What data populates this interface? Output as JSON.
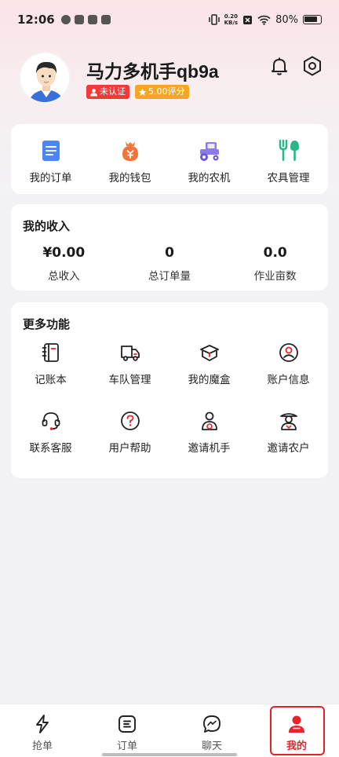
{
  "status_bar": {
    "time": "12:06",
    "speed_value": "0.20",
    "speed_unit": "KB/s",
    "battery": "80%"
  },
  "profile": {
    "name": "马力多机手qb9a",
    "verify_badge": "未认证",
    "rating_badge": "5.00评分"
  },
  "quick_actions": [
    {
      "label": "我的订单",
      "icon": "order-icon"
    },
    {
      "label": "我的钱包",
      "icon": "wallet-icon"
    },
    {
      "label": "我的农机",
      "icon": "tractor-icon"
    },
    {
      "label": "农具管理",
      "icon": "farm-tools-icon"
    }
  ],
  "income": {
    "title": "我的收入",
    "stats": [
      {
        "value": "¥0.00",
        "label": "总收入"
      },
      {
        "value": "0",
        "label": "总订单量"
      },
      {
        "value": "0.0",
        "label": "作业亩数"
      }
    ]
  },
  "more": {
    "title": "更多功能",
    "items": [
      {
        "label": "记账本",
        "icon": "notebook-icon"
      },
      {
        "label": "车队管理",
        "icon": "truck-icon"
      },
      {
        "label": "我的魔盒",
        "icon": "magic-box-icon"
      },
      {
        "label": "账户信息",
        "icon": "account-icon"
      },
      {
        "label": "联系客服",
        "icon": "headset-icon"
      },
      {
        "label": "用户帮助",
        "icon": "help-icon"
      },
      {
        "label": "邀请机手",
        "icon": "invite-driver-icon"
      },
      {
        "label": "邀请农户",
        "icon": "invite-farmer-icon"
      }
    ]
  },
  "tabs": [
    {
      "label": "抢单",
      "icon": "lightning-icon"
    },
    {
      "label": "订单",
      "icon": "order-tab-icon"
    },
    {
      "label": "聊天",
      "icon": "chat-icon"
    },
    {
      "label": "我的",
      "icon": "profile-icon"
    }
  ],
  "colors": {
    "accent": "#e8232b",
    "badge_red": "#f03a3a",
    "badge_orange": "#f5a623"
  }
}
